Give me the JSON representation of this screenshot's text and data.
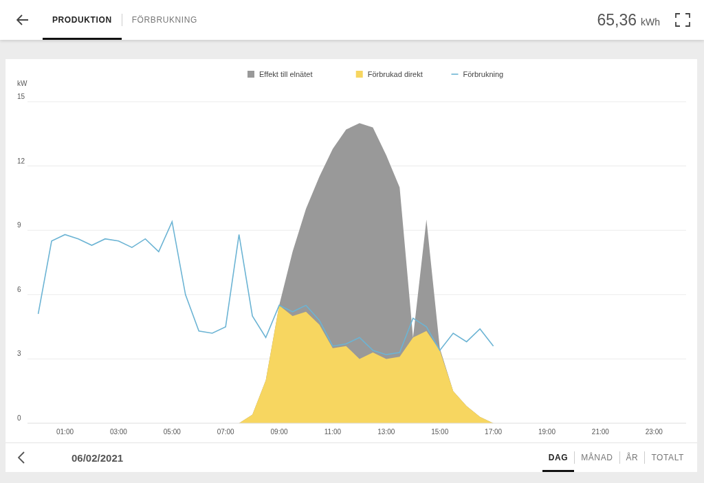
{
  "header": {
    "tabs": [
      {
        "label": "PRODUKTION",
        "selected": true
      },
      {
        "label": "FÖRBRUKNING",
        "selected": false
      }
    ],
    "total": {
      "value": "65,36",
      "unit": "kWh"
    }
  },
  "chart": {
    "chart_data": {
      "type": "area",
      "ylabel": "kW",
      "grid": true,
      "legend": "top",
      "xlim": [
        -0.4,
        24.2
      ],
      "ylim": [
        0,
        15
      ],
      "yticks": [
        0,
        3,
        6,
        9,
        12,
        15
      ],
      "xticks": [
        {
          "value": 1,
          "label": "01:00"
        },
        {
          "value": 3,
          "label": "03:00"
        },
        {
          "value": 5,
          "label": "05:00"
        },
        {
          "value": 7,
          "label": "07:00"
        },
        {
          "value": 9,
          "label": "09:00"
        },
        {
          "value": 11,
          "label": "11:00"
        },
        {
          "value": 13,
          "label": "13:00"
        },
        {
          "value": 15,
          "label": "15:00"
        },
        {
          "value": 17,
          "label": "17:00"
        },
        {
          "value": 19,
          "label": "19:00"
        },
        {
          "value": 21,
          "label": "21:00"
        },
        {
          "value": 23,
          "label": "23:00"
        }
      ],
      "x": [
        0,
        0.5,
        1,
        1.5,
        2,
        2.5,
        3,
        3.5,
        4,
        4.5,
        5,
        5.5,
        6,
        6.5,
        7,
        7.5,
        8,
        8.5,
        9,
        9.5,
        10,
        10.5,
        11,
        11.5,
        12,
        12.5,
        13,
        13.5,
        14,
        14.5,
        15,
        15.5,
        16,
        16.5,
        17
      ],
      "series": [
        {
          "name": "Effekt till elnätet",
          "color": "#999999",
          "type": "area",
          "values": [
            0,
            0,
            0,
            0,
            0,
            0,
            0,
            0,
            0,
            0,
            0,
            0,
            0,
            0,
            0,
            0,
            0.4,
            2.0,
            5.5,
            8.0,
            10.0,
            11.5,
            12.8,
            13.7,
            14.0,
            13.8,
            12.5,
            11.0,
            4.0,
            9.5,
            3.5,
            1.5,
            0.8,
            0.3,
            0
          ]
        },
        {
          "name": "Förbrukad direkt",
          "color": "#f7d660",
          "type": "area",
          "values": [
            0,
            0,
            0,
            0,
            0,
            0,
            0,
            0,
            0,
            0,
            0,
            0,
            0,
            0,
            0,
            0,
            0.4,
            2.0,
            5.5,
            5.0,
            5.2,
            4.6,
            3.5,
            3.6,
            3.0,
            3.3,
            3.0,
            3.1,
            4.0,
            4.3,
            3.4,
            1.5,
            0.8,
            0.3,
            0
          ]
        },
        {
          "name": "Förbrukning",
          "color": "#6cb4d4",
          "type": "line",
          "values": [
            5.1,
            8.5,
            8.8,
            8.6,
            8.3,
            8.6,
            8.5,
            8.2,
            8.6,
            8.0,
            9.4,
            6.0,
            4.3,
            4.2,
            4.5,
            8.8,
            5.0,
            4.0,
            5.5,
            5.2,
            5.5,
            4.8,
            3.6,
            3.7,
            4.0,
            3.4,
            3.2,
            3.3,
            4.9,
            4.5,
            3.4,
            4.2,
            3.8,
            4.4,
            3.6
          ]
        }
      ]
    }
  },
  "footer": {
    "date": "06/02/2021",
    "periods": [
      {
        "label": "DAG",
        "selected": true
      },
      {
        "label": "MÅNAD",
        "selected": false
      },
      {
        "label": "ÅR",
        "selected": false
      },
      {
        "label": "TOTALT",
        "selected": false
      }
    ]
  }
}
